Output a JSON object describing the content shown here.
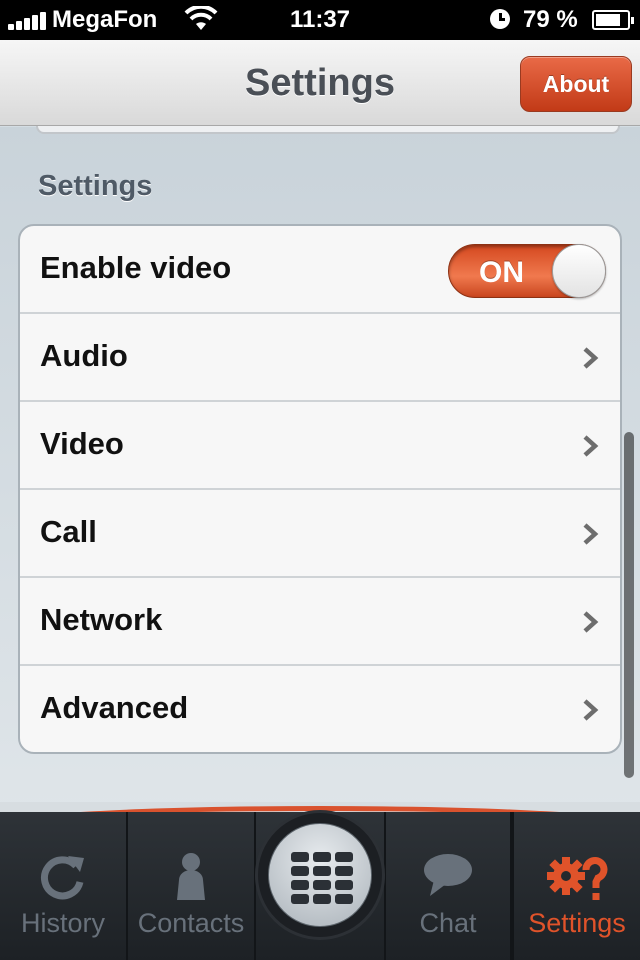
{
  "status_bar": {
    "carrier": "MegaFon",
    "time": "11:37",
    "battery_percent": "79 %",
    "icons": [
      "signal-icon",
      "wifi-icon",
      "alarm-clock-icon",
      "battery-icon"
    ]
  },
  "nav": {
    "title": "Settings",
    "about_label": "About"
  },
  "section": {
    "header": "Settings"
  },
  "settings_rows": {
    "enable_video": {
      "label": "Enable video",
      "toggle_label": "ON",
      "toggle_on": true
    },
    "items": [
      {
        "label": "Audio"
      },
      {
        "label": "Video"
      },
      {
        "label": "Call"
      },
      {
        "label": "Network"
      },
      {
        "label": "Advanced"
      }
    ]
  },
  "tab_bar": {
    "tabs": [
      {
        "label": "History",
        "icon": "refresh-icon",
        "active": false
      },
      {
        "label": "Contacts",
        "icon": "person-icon",
        "active": false
      },
      {
        "label": "",
        "icon": "dialpad-icon",
        "active": false
      },
      {
        "label": "Chat",
        "icon": "chat-bubble-icon",
        "active": false
      },
      {
        "label": "Settings",
        "icon": "gear-question-icon",
        "active": true
      }
    ]
  },
  "colors": {
    "accent": "#d9522e",
    "tab_inactive": "#68717b",
    "nav_title": "#4a4f56"
  }
}
